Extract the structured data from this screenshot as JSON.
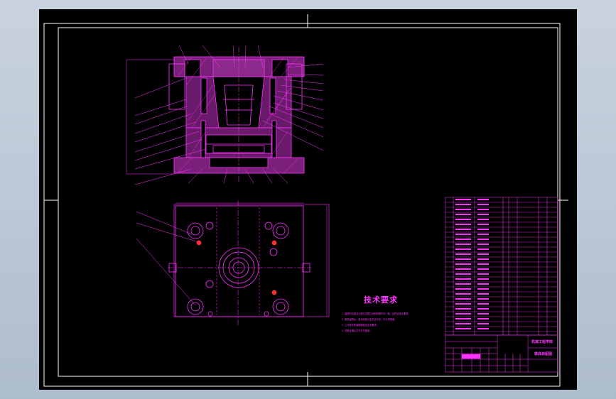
{
  "drawing": {
    "tech_title": "技术要求",
    "notes": [
      "1. 装配时应保证凸模与凹模之间的间隙均匀一致，且符合设计要求。",
      "2. 模具装配后，各活动部分应灵活可靠，无卡滞现象。",
      "3. 工作零件表面粗糙度应达到要求。",
      "4. 试模合格后方可交付使用。"
    ],
    "title_block": {
      "school": "机械工程学院",
      "drawing_name": "模具装配图"
    }
  },
  "colors": {
    "lines": "#ff33ff",
    "frame": "#ffffff",
    "background": "#000000"
  }
}
